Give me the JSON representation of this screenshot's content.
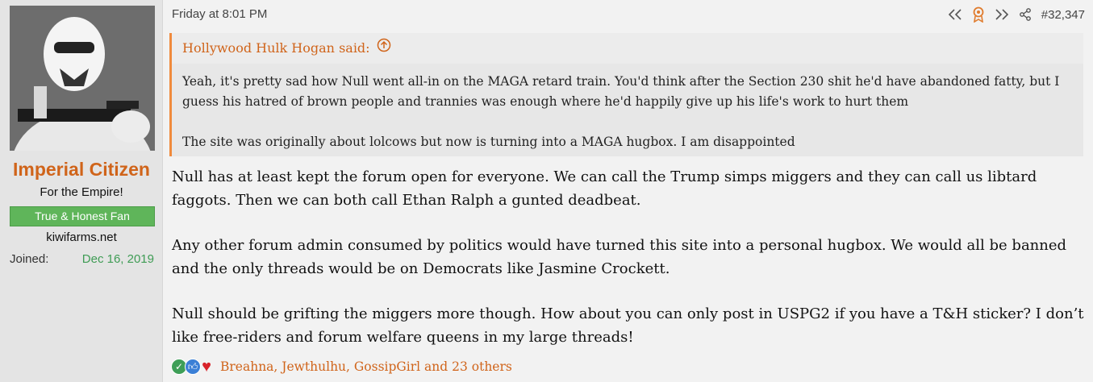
{
  "user": {
    "name": "Imperial Citizen",
    "title": "For the Empire!",
    "banner": "True & Honest Fan",
    "site": "kiwifarms.net",
    "joined_label": "Joined:",
    "joined_value": "Dec 16, 2019"
  },
  "post": {
    "timestamp": "Friday at 8:01 PM",
    "number": "#32,347",
    "quote_author": "Hollywood Hulk Hogan said:",
    "quote_paragraphs": [
      "Yeah, it's pretty sad how Null went all-in on the MAGA retard train. You'd think after the Section 230 shit he'd have abandoned fatty, but I guess his hatred of brown people and trannies was enough where he'd happily give up his life's work to hurt them",
      "The site was originally about lolcows but now is turning into a MAGA hugbox. I am disappointed"
    ],
    "body_paragraphs": [
      "Null has at least kept the forum open for everyone. We can call the Trump simps miggers and they can call us libtard faggots. Then we can both call Ethan Ralph a gunted deadbeat.",
      "Any other forum admin consumed by politics would have turned this site into a personal hugbox. We would all be banned and the only threads would be on Democrats like Jasmine Crockett.",
      "Null should be grifting the miggers more though. How about you can only post in USPG2 if you have a T&H sticker? I don’t like free-riders and forum welfare queens in my large threads!"
    ],
    "reactions_text": "Breahna, Jewthulhu, GossipGirl and 23 others"
  },
  "icons": {
    "rewind": "rewind-icon",
    "award": "award-icon",
    "fast_forward": "fast-forward-icon",
    "share": "share-icon",
    "quote_arrow": "circle-arrow-up-icon",
    "reaction1": "check-reaction-icon",
    "reaction2": "thumbs-up-reaction-icon",
    "reaction3": "heart-reaction-icon"
  },
  "colors": {
    "accent": "#d0641a",
    "banner": "#5fb55a",
    "joined": "#3f9c55"
  }
}
